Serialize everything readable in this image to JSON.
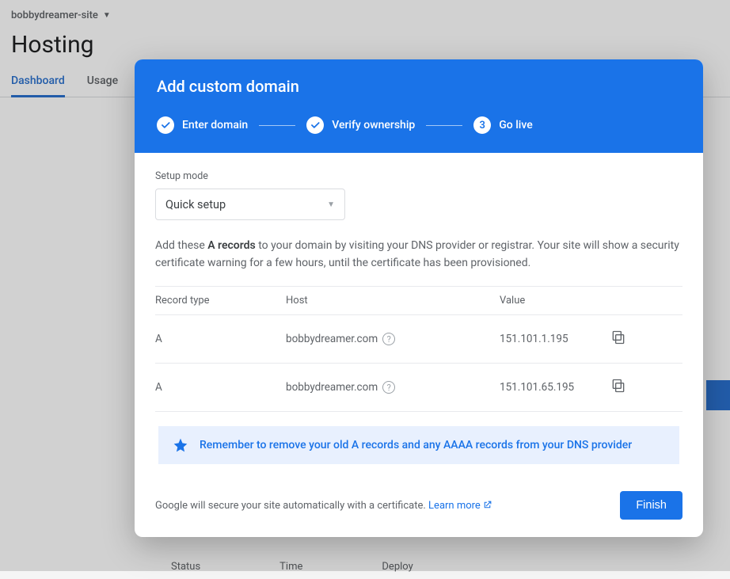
{
  "project": {
    "name": "bobbydreamer-site"
  },
  "page": {
    "title": "Hosting"
  },
  "tabs": {
    "dashboard": "Dashboard",
    "usage": "Usage"
  },
  "bg_table": {
    "status": "Status",
    "time": "Time",
    "deploy": "Deploy"
  },
  "dialog": {
    "title": "Add custom domain",
    "steps": {
      "s1": "Enter domain",
      "s2": "Verify ownership",
      "s3_num": "3",
      "s3": "Go live"
    },
    "setup_label": "Setup mode",
    "select_value": "Quick setup",
    "instruction_prefix": "Add these ",
    "instruction_bold": "A records",
    "instruction_suffix": " to your domain by visiting your DNS provider or registrar. Your site will show a security certificate warning for a few hours, until the certificate has been provisioned.",
    "columns": {
      "type": "Record type",
      "host": "Host",
      "value": "Value"
    },
    "records": [
      {
        "type": "A",
        "host": "bobbydreamer.com",
        "value": "151.101.1.195"
      },
      {
        "type": "A",
        "host": "bobbydreamer.com",
        "value": "151.101.65.195"
      }
    ],
    "note": "Remember to remove your old A records and any AAAA records from your DNS provider",
    "footer_text": "Google will secure your site automatically with a certificate. ",
    "learn_more": "Learn more",
    "finish": "Finish"
  }
}
